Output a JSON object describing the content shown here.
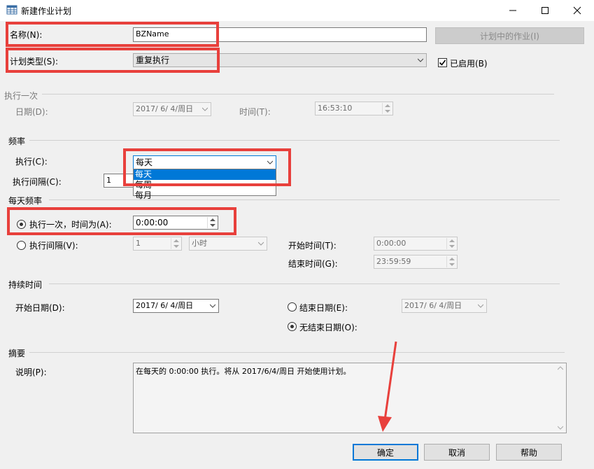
{
  "window": {
    "title": "新建作业计划",
    "icon": "table-icon",
    "controls": [
      "minimize",
      "maximize",
      "close"
    ]
  },
  "name_field": {
    "label": "名称(N):",
    "value": "BZName"
  },
  "jobs_in_schedule_button": "计划中的作业(I)",
  "schedule_type": {
    "label": "计划类型(S):",
    "value": "重复执行"
  },
  "enabled_checkbox": {
    "label": "已启用(B)",
    "checked": true
  },
  "one_time": {
    "section_label": "执行一次",
    "date_label": "日期(D):",
    "date_value": "2017/ 6/ 4/周日",
    "time_label": "时间(T):",
    "time_value": "16:53:10"
  },
  "frequency": {
    "section_label": "频率",
    "occurs_label": "执行(C):",
    "occurs_value": "每天",
    "options": [
      "每天",
      "每周",
      "每月"
    ],
    "selected_index": 0,
    "interval_label": "执行间隔(C):",
    "interval_value": "1"
  },
  "daily_frequency": {
    "section_label": "每天频率",
    "once_label": "执行一次，时间为(A):",
    "once_value": "0:00:00",
    "once_selected": true,
    "every_label": "执行间隔(V):",
    "every_value": "1",
    "every_unit": "小时",
    "start_time_label": "开始时间(T):",
    "start_time_value": "0:00:00",
    "end_time_label": "结束时间(G):",
    "end_time_value": "23:59:59"
  },
  "duration": {
    "section_label": "持续时间",
    "start_date_label": "开始日期(D):",
    "start_date_value": "2017/ 6/ 4/周日",
    "end_date_label": "结束日期(E):",
    "end_date_value": "2017/ 6/ 4/周日",
    "no_end_label": "无结束日期(O):",
    "no_end_selected": true
  },
  "summary": {
    "section_label": "摘要",
    "description_label": "说明(P):",
    "description_value": "在每天的 0:00:00 执行。将从 2017/6/4/周日 开始使用计划。"
  },
  "buttons": {
    "ok": "确定",
    "cancel": "取消",
    "help": "帮助"
  },
  "annotation_color": "#e8403c"
}
